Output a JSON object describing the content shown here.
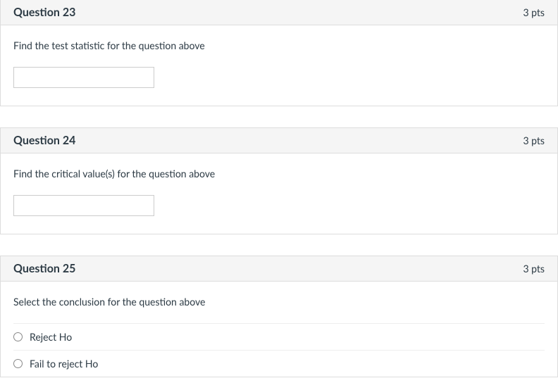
{
  "questions": [
    {
      "title": "Question 23",
      "points": "3 pts",
      "prompt": "Find the test statistic for the question above",
      "type": "text_input"
    },
    {
      "title": "Question 24",
      "points": "3 pts",
      "prompt": "Find the critical value(s) for the question above",
      "type": "text_input"
    },
    {
      "title": "Question 25",
      "points": "3 pts",
      "prompt": "Select the conclusion for the question above",
      "type": "radio",
      "options": [
        "Reject Ho",
        "Fail to reject Ho"
      ]
    }
  ]
}
